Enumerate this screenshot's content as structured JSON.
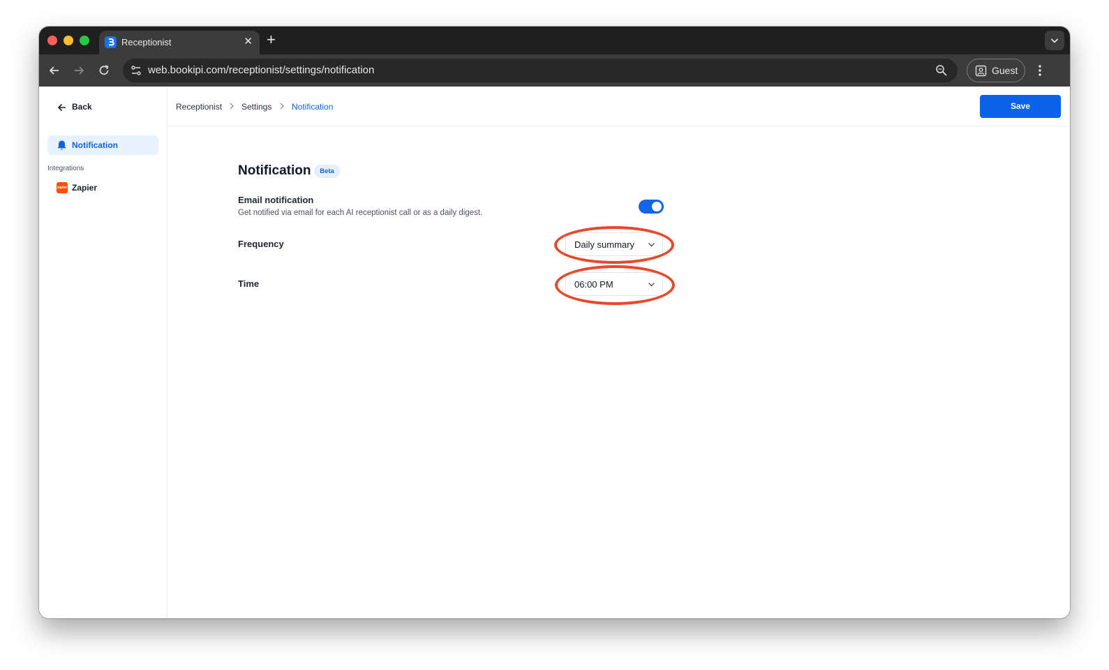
{
  "browser": {
    "tab_title": "Receptionist",
    "tab_favicon_letter": "[",
    "url": "web.bookipi.com/receptionist/settings/notification",
    "profile_label": "Guest"
  },
  "sidebar": {
    "back_label": "Back",
    "active_item": "Notification",
    "section_label": "Integrations",
    "integration_label": "Zapier",
    "integration_logo_text": "zapier"
  },
  "breadcrumb": {
    "items": [
      "Receptionist",
      "Settings",
      "Notification"
    ]
  },
  "header": {
    "save_label": "Save"
  },
  "main": {
    "title": "Notification",
    "badge": "Beta",
    "email": {
      "label": "Email notification",
      "description": "Get notified via email for each AI receptionist call or as a daily digest.",
      "enabled": true
    },
    "frequency": {
      "label": "Frequency",
      "value": "Daily summary"
    },
    "time": {
      "label": "Time",
      "value": "06:00 PM"
    }
  },
  "colors": {
    "accent": "#0a63e8",
    "annotation": "#e8482a"
  }
}
